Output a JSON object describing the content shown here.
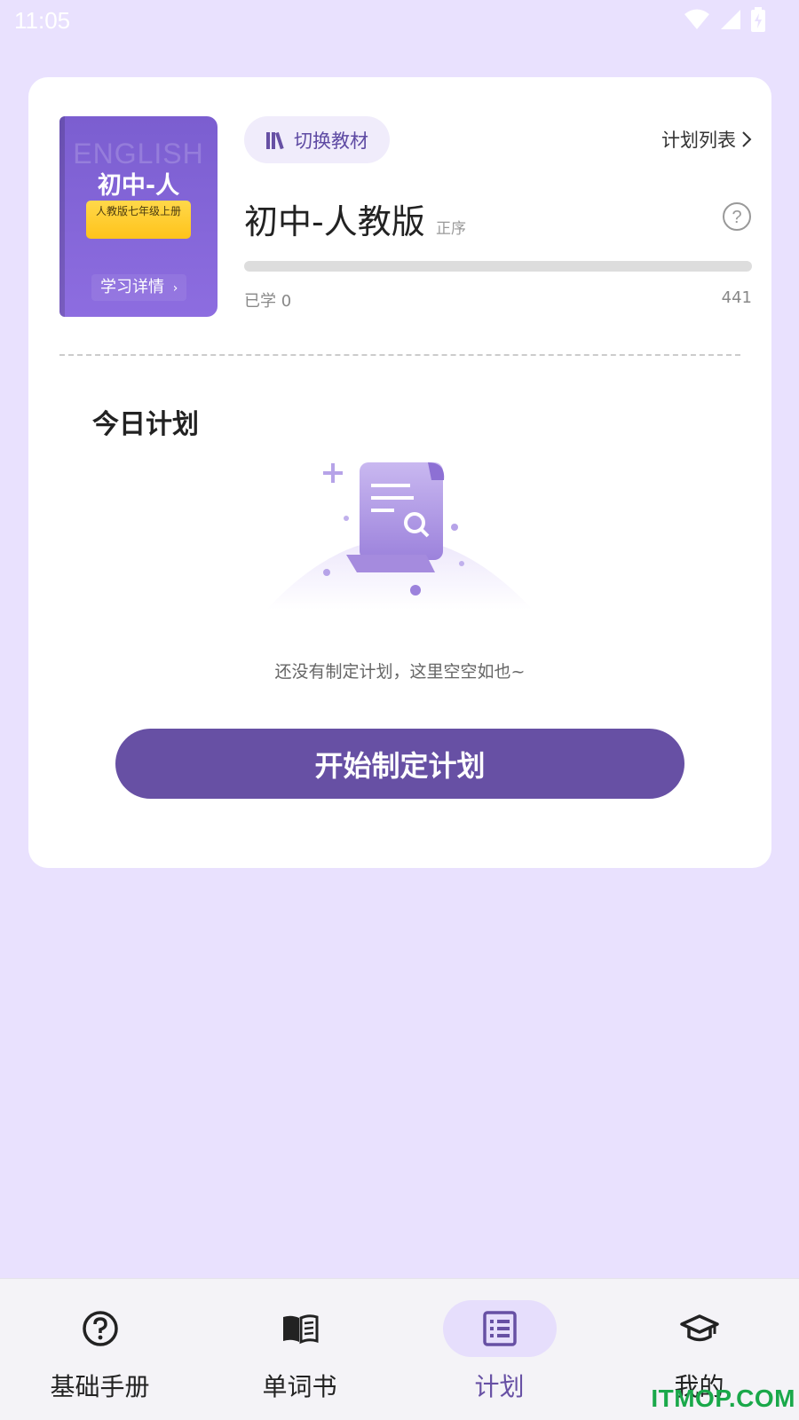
{
  "status_bar": {
    "time": "11:05"
  },
  "book": {
    "cover_en": "ENGLISH",
    "cover_title": "初中-人",
    "cover_tag": "人教版七年级上册",
    "detail_label": "学习详情",
    "name": "初中-人教版",
    "order": "正序",
    "progress": 0,
    "learned_label": "已学 0",
    "total_words": "441"
  },
  "header": {
    "switch_label": "切换教材",
    "plan_list_label": "计划列表"
  },
  "today": {
    "title": "今日计划",
    "empty_text": "还没有制定计划，这里空空如也~",
    "start_button": "开始制定计划"
  },
  "nav": {
    "items": [
      {
        "label": "基础手册",
        "icon": "help-circle-icon"
      },
      {
        "label": "单词书",
        "icon": "open-book-icon"
      },
      {
        "label": "计划",
        "icon": "list-icon",
        "active": true
      },
      {
        "label": "我的",
        "icon": "graduation-cap-icon"
      }
    ]
  },
  "watermark": "ITMOP.COM",
  "colors": {
    "accent": "#6750a4",
    "background": "#e9e1fe",
    "card": "#ffffff"
  }
}
